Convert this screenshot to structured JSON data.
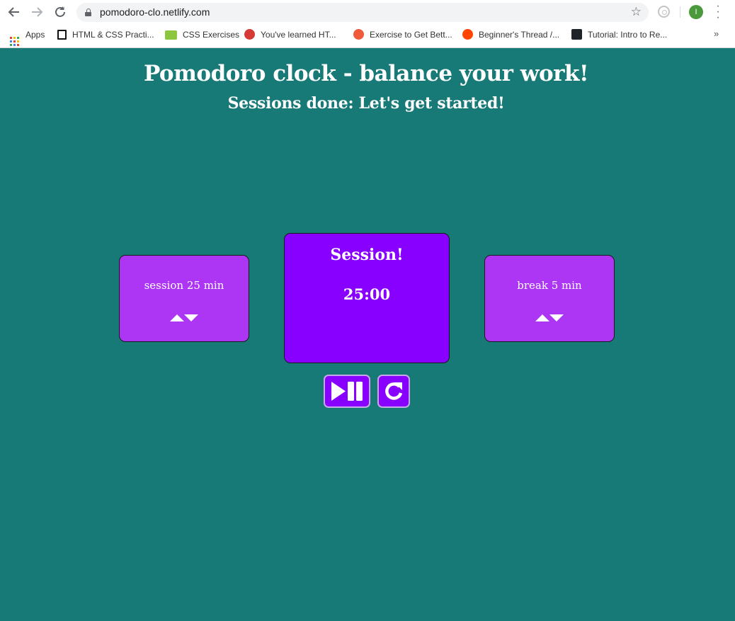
{
  "browser": {
    "url": "pomodoro-clo.netlify.com",
    "avatar_letter": "I",
    "bookmarks": [
      {
        "label": "Apps",
        "icon": "apps-grid-icon"
      },
      {
        "label": "HTML & CSS Practi...",
        "icon": "brackets-icon"
      },
      {
        "label": "CSS Exercises",
        "icon": "exercism-icon"
      },
      {
        "label": "You've learned HT...",
        "icon": "codecademy-icon"
      },
      {
        "label": "Exercise to Get Bett...",
        "icon": "asterisk-icon"
      },
      {
        "label": "Beginner's Thread /...",
        "icon": "reddit-icon"
      },
      {
        "label": "Tutorial: Intro to Re...",
        "icon": "react-icon"
      }
    ],
    "more_label": "»"
  },
  "page": {
    "title": "Pomodoro clock - balance your work!",
    "subtitle": "Sessions done: Let's get started!",
    "session_setting": "session 25 min",
    "break_setting": "break 5 min",
    "timer_label": "Session!",
    "timer_value": "25:00",
    "colors": {
      "background": "#187a77",
      "timer_card": "#8800ff",
      "setting_card": "#ad36f5",
      "text": "#ffffff"
    },
    "icons": {
      "increment": "triangle-up-icon",
      "decrement": "triangle-down-icon",
      "play_pause": "play-pause-icon",
      "reset": "refresh-icon"
    }
  }
}
